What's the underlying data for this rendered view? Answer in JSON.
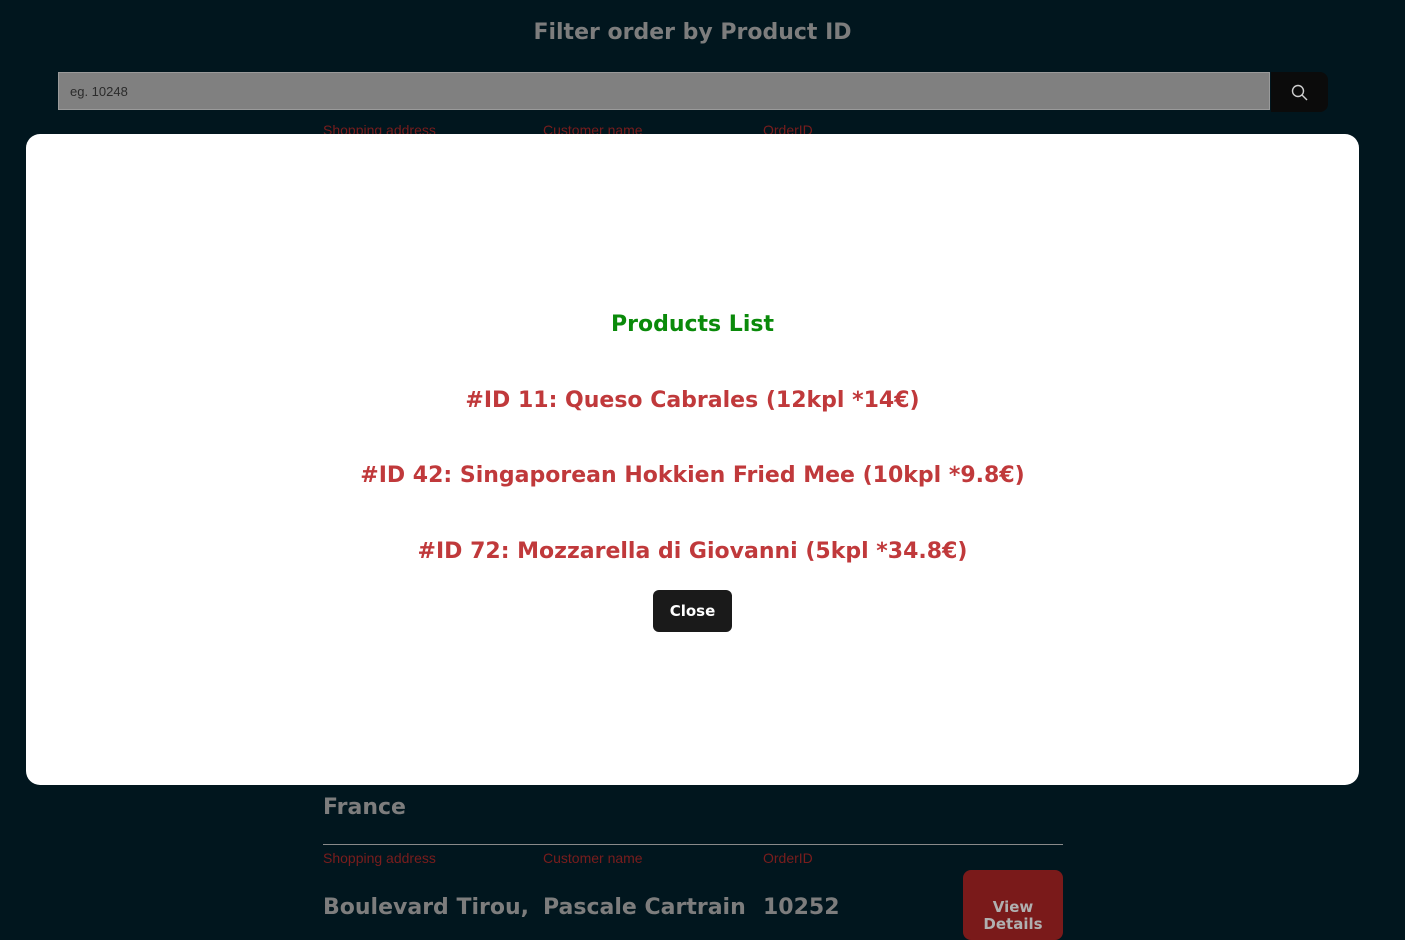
{
  "header": {
    "title": "Filter order by Product ID"
  },
  "search": {
    "placeholder": "eg. 10248",
    "value": "",
    "button_icon": "search-icon"
  },
  "labels": {
    "address": "Shopping address",
    "customer": "Customer name",
    "order_id": "OrderID"
  },
  "orders": [
    {
      "address_tail": "France"
    },
    {
      "address": "Boulevard Tirou,",
      "customer": "Pascale Cartrain",
      "order_id": "10252",
      "button": "View Details"
    }
  ],
  "modal": {
    "title": "Products List",
    "items": [
      "#ID 11: Queso Cabrales (12kpl *14€)",
      "#ID 42: Singaporean Hokkien Fried Mee (10kpl *9.8€)",
      "#ID 72: Mozzarella di Giovanni (5kpl *34.8€)"
    ],
    "close_label": "Close"
  },
  "colors": {
    "background": "#01161e",
    "label": "#7a1d1d",
    "modal_title": "#0a8a0a",
    "product_text": "#c0393b",
    "view_button": "#7a1a1a"
  }
}
